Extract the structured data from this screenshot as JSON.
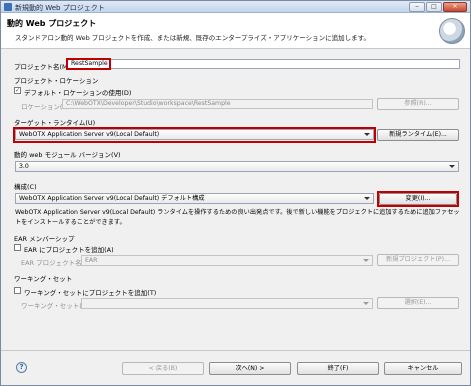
{
  "window": {
    "title": "新規動的 Web プロジェクト",
    "controls": {
      "minimize": "‒",
      "maximize": "□",
      "close": "✕"
    }
  },
  "header": {
    "title": "動的 Web プロジェクト",
    "description": "スタンドアロン動的 Web プロジェクトを作成、または新規、既存のエンタープライズ・アプリケーションに追加します。",
    "logo_icon": "web-project-globe-icon"
  },
  "project": {
    "name_label": "プロジェクト名(M):",
    "name_value": "RestSample"
  },
  "location": {
    "section_label": "プロジェクト・ロケーション",
    "default_checkbox_label": "デフォルト・ロケーションの使用(D)",
    "default_checked": true,
    "location_label": "ロケーション(L):",
    "location_value": "C:\\WebOTX\\Developer\\Studio\\workspace\\RestSample",
    "browse_label": "参照(R)..."
  },
  "target_runtime": {
    "label": "ターゲット・ランタイム(U)",
    "value": "WebOTX Application Server v9(Local Default)",
    "new_runtime_label": "新規ランタイム(E)..."
  },
  "module_version": {
    "label": "動的 web モジュール バージョン(V)",
    "value": "3.0"
  },
  "configuration": {
    "label": "構成(C)",
    "value": "WebOTX Application Server v9(Local Default) デフォルト構成",
    "modify_label": "変更(I)...",
    "description": "WebOTX Application Server v9(Local Default) ランタイムを操作するための良い出発点です。後で新しい機能をプロジェクトに追加するために追加ファセットをインストールすることができます。"
  },
  "ear": {
    "section_label": "EAR メンバーシップ",
    "checkbox_label": "EAR にプロジェクトを追加(A)",
    "checked": false,
    "project_name_label": "EAR プロジェクト名(E):",
    "project_name_value": "EAR",
    "new_project_label": "新規プロジェクト(P)..."
  },
  "working_set": {
    "section_label": "ワーキング・セット",
    "checkbox_label": "ワーキング・セットにプロジェクトを追加(T)",
    "checked": false,
    "sets_label": "ワーキング・セット(O):",
    "sets_value": "",
    "select_label": "選択(E)..."
  },
  "footer": {
    "help_icon": "help-icon",
    "help_glyph": "?",
    "back_label": "< 戻る(B)",
    "next_label": "次へ(N) >",
    "finish_label": "終了(F)",
    "cancel_label": "キャンセル"
  }
}
